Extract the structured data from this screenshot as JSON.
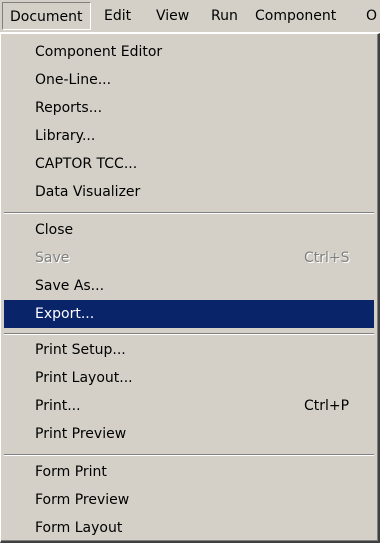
{
  "menubar": {
    "items": [
      {
        "label": "Document"
      },
      {
        "label": "Edit"
      },
      {
        "label": "View"
      },
      {
        "label": "Run"
      },
      {
        "label": "Component"
      },
      {
        "label": "O"
      }
    ]
  },
  "menu": {
    "items": [
      {
        "label": "Component Editor",
        "shortcut": ""
      },
      {
        "label": "One-Line...",
        "shortcut": ""
      },
      {
        "label": "Reports...",
        "shortcut": ""
      },
      {
        "label": "Library...",
        "shortcut": ""
      },
      {
        "label": "CAPTOR TCC...",
        "shortcut": ""
      },
      {
        "label": "Data Visualizer",
        "shortcut": ""
      },
      {
        "label": "Close",
        "shortcut": ""
      },
      {
        "label": "Save",
        "shortcut": "Ctrl+S"
      },
      {
        "label": "Save As...",
        "shortcut": ""
      },
      {
        "label": "Export...",
        "shortcut": ""
      },
      {
        "label": "Print Setup...",
        "shortcut": ""
      },
      {
        "label": "Print Layout...",
        "shortcut": ""
      },
      {
        "label": "Print...",
        "shortcut": "Ctrl+P"
      },
      {
        "label": "Print Preview",
        "shortcut": ""
      },
      {
        "label": "Form Print",
        "shortcut": ""
      },
      {
        "label": "Form Preview",
        "shortcut": ""
      },
      {
        "label": "Form Layout",
        "shortcut": ""
      }
    ]
  }
}
